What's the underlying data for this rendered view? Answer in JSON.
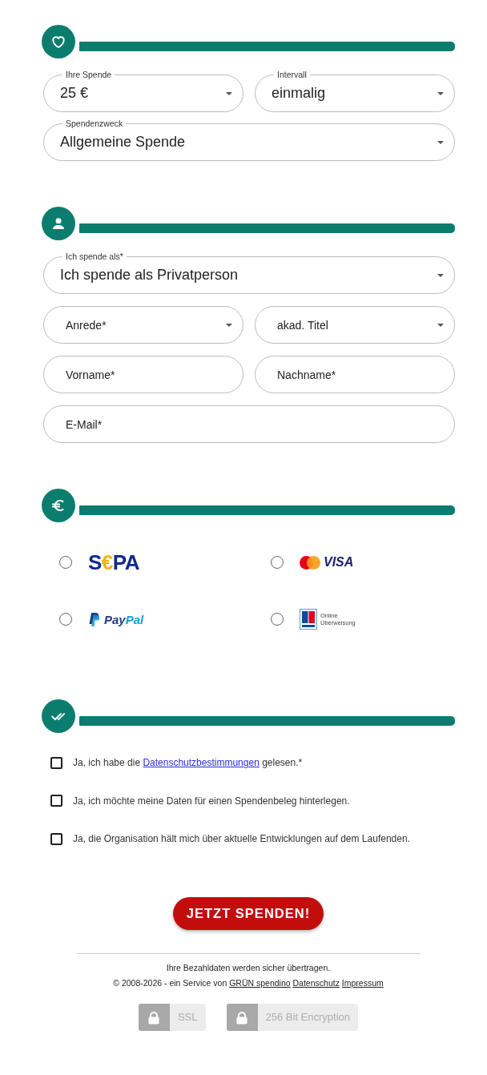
{
  "sections": [
    {
      "kind": "donation",
      "rows": [
        {
          "fields": [
            {
              "kind": "select",
              "label": "Ihre Spende",
              "value": "25 €"
            },
            {
              "kind": "select",
              "label": "Intervall",
              "value": "einmalig"
            }
          ]
        },
        {
          "fields": [
            {
              "kind": "select",
              "label": "Spendenzweck",
              "value": "Allgemeine Spende"
            }
          ]
        }
      ]
    },
    {
      "kind": "donor",
      "rows": [
        {
          "fields": [
            {
              "kind": "select",
              "label": "Ich spende als*",
              "value": "Ich spende als Privatperson"
            }
          ]
        },
        {
          "fields": [
            {
              "kind": "select",
              "placeholder": "Anrede*"
            },
            {
              "kind": "select",
              "placeholder": "akad. Titel"
            }
          ]
        },
        {
          "fields": [
            {
              "kind": "text",
              "placeholder": "Vorname*"
            },
            {
              "kind": "text",
              "placeholder": "Nachname*"
            }
          ]
        },
        {
          "fields": [
            {
              "kind": "text",
              "placeholder": "E-Mail*"
            }
          ]
        }
      ]
    },
    {
      "kind": "payment",
      "methods": [
        {
          "kind": "sepa",
          "logo_text": "S€PA",
          "selected": false
        },
        {
          "kind": "card",
          "logo_text": "VISA",
          "selected": false
        },
        {
          "kind": "paypal",
          "logo_text": "PayPal",
          "selected": false
        },
        {
          "kind": "transfer",
          "logo_text": "Online Überweisung",
          "selected": false
        }
      ]
    },
    {
      "kind": "consent",
      "checkboxes": [
        {
          "text": "Ja, ich habe die",
          "link": "Datenschutzbestimmungen",
          "text_after": "gelesen.*",
          "checked": false
        },
        {
          "text": "Ja, ich möchte meine Daten für einen Spendenbeleg hinterlegen.",
          "checked": false
        },
        {
          "text": "Ja, die Organisation hält mich über aktuelle Entwicklungen auf dem Laufenden.",
          "checked": false
        }
      ]
    }
  ],
  "footer": {
    "submit_button": "JETZT SPENDEN!",
    "security_note": "Ihre Bezahldaten werden sicher übertragen.",
    "copyright": "© 2008-2026 - ein Service von",
    "links": [
      "GRÜN spendino",
      "Datenschutz",
      "Impressum"
    ],
    "badges": [
      "SSL",
      "256 Bit Encryption"
    ]
  }
}
